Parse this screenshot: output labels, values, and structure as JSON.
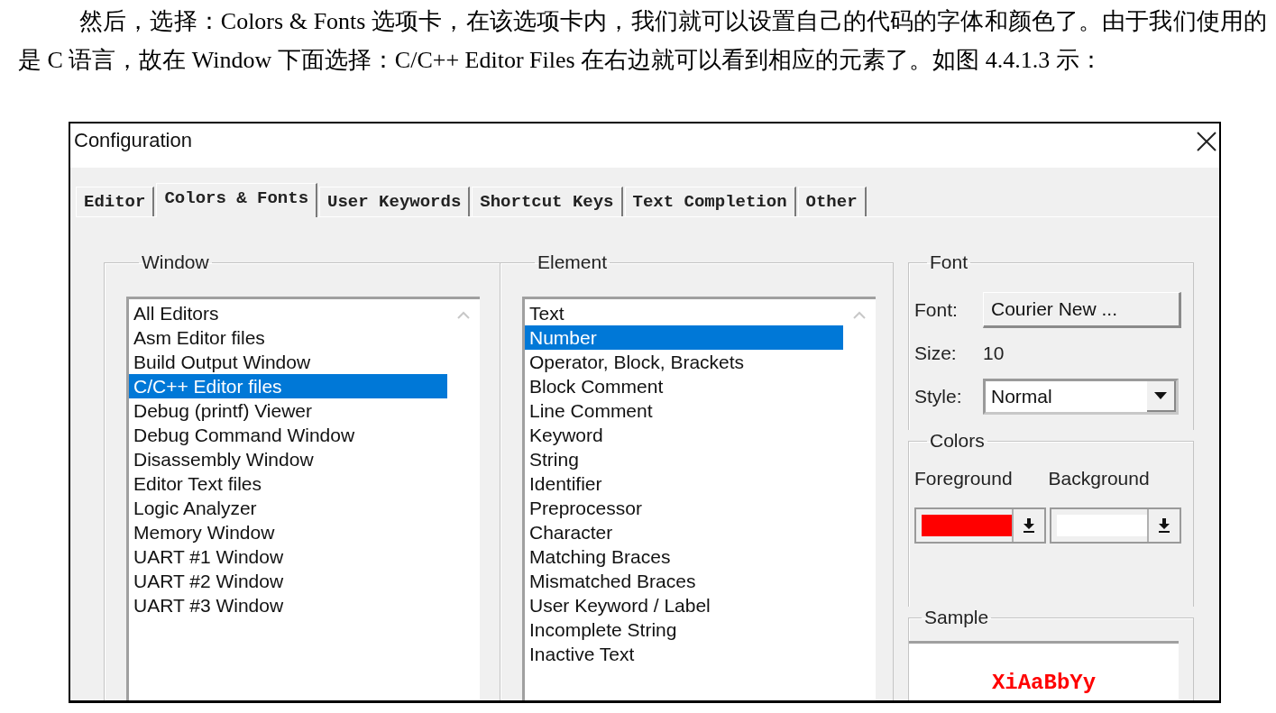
{
  "paragraph": "然后，选择：Colors & Fonts 选项卡，在该选项卡内，我们就可以设置自己的代码的字体和颜色了。由于我们使用的是 C 语言，故在 Window 下面选择：C/C++ Editor Files 在右边就可以看到相应的元素了。如图 4.4.1.3 示：",
  "dialog": {
    "title": "Configuration",
    "tabs": [
      {
        "label": "Editor",
        "selected": false
      },
      {
        "label": "Colors & Fonts",
        "selected": true
      },
      {
        "label": "User Keywords",
        "selected": false
      },
      {
        "label": "Shortcut Keys",
        "selected": false
      },
      {
        "label": "Text Completion",
        "selected": false
      },
      {
        "label": "Other",
        "selected": false
      }
    ],
    "window_group": {
      "label": "Window",
      "items": [
        {
          "label": "All Editors",
          "selected": false
        },
        {
          "label": "Asm Editor files",
          "selected": false
        },
        {
          "label": "Build Output Window",
          "selected": false
        },
        {
          "label": "C/C++ Editor files",
          "selected": true
        },
        {
          "label": "Debug (printf) Viewer",
          "selected": false
        },
        {
          "label": "Debug Command Window",
          "selected": false
        },
        {
          "label": "Disassembly Window",
          "selected": false
        },
        {
          "label": "Editor Text files",
          "selected": false
        },
        {
          "label": "Logic Analyzer",
          "selected": false
        },
        {
          "label": "Memory Window",
          "selected": false
        },
        {
          "label": "UART #1 Window",
          "selected": false
        },
        {
          "label": "UART #2 Window",
          "selected": false
        },
        {
          "label": "UART #3 Window",
          "selected": false
        }
      ]
    },
    "element_group": {
      "label": "Element",
      "items": [
        {
          "label": "Text",
          "selected": false
        },
        {
          "label": "Number",
          "selected": true
        },
        {
          "label": "Operator, Block, Brackets",
          "selected": false
        },
        {
          "label": "Block Comment",
          "selected": false
        },
        {
          "label": "Line Comment",
          "selected": false
        },
        {
          "label": "Keyword",
          "selected": false
        },
        {
          "label": "String",
          "selected": false
        },
        {
          "label": "Identifier",
          "selected": false
        },
        {
          "label": "Preprocessor",
          "selected": false
        },
        {
          "label": "Character",
          "selected": false
        },
        {
          "label": "Matching Braces",
          "selected": false
        },
        {
          "label": "Mismatched Braces",
          "selected": false
        },
        {
          "label": "User Keyword / Label",
          "selected": false
        },
        {
          "label": "Incomplete String",
          "selected": false
        },
        {
          "label": "Inactive Text",
          "selected": false
        }
      ]
    },
    "font_group": {
      "label": "Font",
      "font_label": "Font:",
      "font_button": "Courier New ...",
      "size_label": "Size:",
      "size": "10",
      "style_label": "Style:",
      "style": "Normal"
    },
    "colors_group": {
      "label": "Colors",
      "foreground_label": "Foreground",
      "background_label": "Background",
      "foreground": {
        "color": "#ff0000"
      },
      "background": {
        "color": "#ffffff"
      }
    },
    "sample_group": {
      "label": "Sample",
      "text": "XiAaBbYy"
    }
  }
}
